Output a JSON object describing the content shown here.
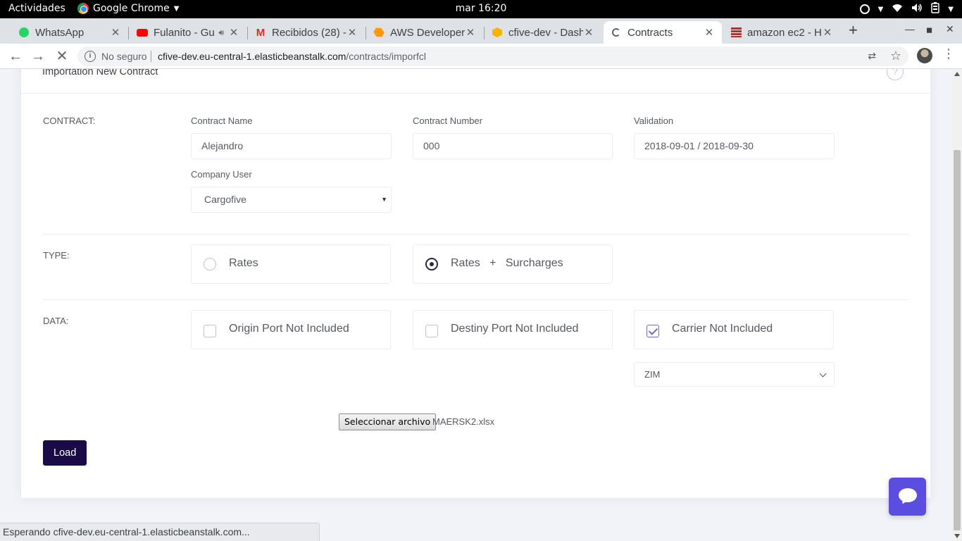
{
  "system_bar": {
    "activities": "Actividades",
    "app_name": "Google Chrome",
    "clock": "mar 16:20"
  },
  "tabs": [
    {
      "title": "WhatsApp",
      "icon": "whatsapp-icon",
      "color": "#25d366"
    },
    {
      "title": "Fulanito - Gu",
      "icon": "youtube-icon",
      "color": "#ff0000",
      "audio": true
    },
    {
      "title": "Recibidos (28) -",
      "icon": "gmail-icon",
      "color": "#d93025"
    },
    {
      "title": "AWS Developer",
      "icon": "aws-icon",
      "color": "#f90"
    },
    {
      "title": "cfive-dev - Dash",
      "icon": "elastic-beanstalk-icon",
      "color": "#f4b400"
    },
    {
      "title": "Contracts",
      "icon": "loading-spinner-icon",
      "active": true
    },
    {
      "title": "amazon ec2 - H",
      "icon": "stackoverflow-icon",
      "color": "#c62828"
    }
  ],
  "toolbar": {
    "security": "No seguro",
    "url_host": "cfive-dev.eu-central-1.elasticbeanstalk.com",
    "url_path": "/contracts/imporfcl"
  },
  "card": {
    "title": "Importation New Contract",
    "help": "?"
  },
  "contract": {
    "section_label": "CONTRACT:",
    "name_label": "Contract Name",
    "name_value": "Alejandro",
    "number_label": "Contract Number",
    "number_value": "000",
    "validation_label": "Validation",
    "validation_value": "2018-09-01 / 2018-09-30",
    "company_label": "Company User",
    "company_value": "Cargofive"
  },
  "type": {
    "section_label": "TYPE:",
    "options": [
      {
        "label": "Rates",
        "selected": false
      },
      {
        "label": "Rates   +   Surcharges",
        "selected": true
      }
    ]
  },
  "data": {
    "section_label": "DATA:",
    "options": [
      {
        "label": "Origin Port Not Included",
        "checked": false
      },
      {
        "label": "Destiny Port Not Included",
        "checked": false
      },
      {
        "label": "Carrier Not Included",
        "checked": true
      }
    ],
    "carrier_value": "ZIM"
  },
  "file": {
    "button_label": "Seleccionar archivo",
    "file_name": "MAERSK2.xlsx"
  },
  "load_button": "Load",
  "status_bar": "Esperando cfive-dev.eu-central-1.elasticbeanstalk.com..."
}
